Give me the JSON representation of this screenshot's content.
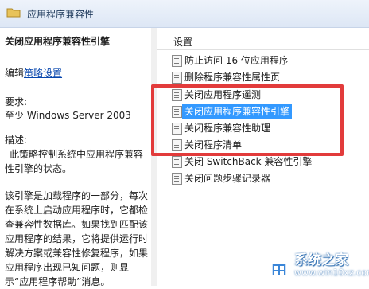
{
  "header": {
    "title": "应用程序兼容性"
  },
  "left": {
    "policy_title": "关闭应用程序兼容性引擎",
    "edit_prefix": "编辑",
    "edit_link": "策略设置",
    "requirements_label": "要求:",
    "requirements_value": "至少 Windows Server 2003",
    "description_label": "描述:",
    "description_p1": "此策略控制系统中应用程序兼容性引擎的状态。",
    "description_p2": "该引擎是加载程序的一部分，每次在系统上启动应用程序时，它都检查兼容性数据库。如果找到匹配该应用程序的结果，它将提供运行时解决方案或兼容性修复程序，如果应用程序出现已知问题，则显示“应用程序帮助”消息。"
  },
  "right": {
    "column_header": "设置",
    "items": [
      {
        "label": "防止访问 16 位应用程序"
      },
      {
        "label": "删除程序兼容性属性页"
      },
      {
        "label": "关闭应用程序遥测"
      },
      {
        "label": "关闭应用程序兼容性引擎"
      },
      {
        "label": "关闭程序兼容性助理"
      },
      {
        "label": "关闭程序清单"
      },
      {
        "label": "关闭 SwitchBack 兼容性引擎"
      },
      {
        "label": "关闭问题步骤记录器"
      }
    ],
    "selected_index": 3
  },
  "watermark": {
    "brand": "系统之家",
    "url": "www.win10xz.com"
  },
  "colors": {
    "highlight": "#3399ff",
    "annotation": "#e23b3b"
  }
}
